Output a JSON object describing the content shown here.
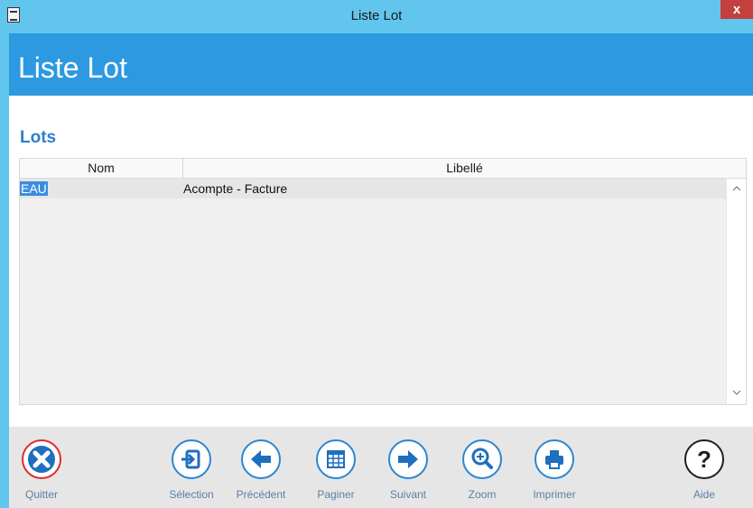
{
  "window": {
    "title": "Liste Lot",
    "close_label": "x"
  },
  "header": {
    "title": "Liste Lot"
  },
  "section": {
    "title": "Lots"
  },
  "table": {
    "columns": [
      "Nom",
      "Libellé"
    ],
    "rows": [
      {
        "nom": "EAU",
        "libelle": "Acompte - Facture",
        "selected_column": "nom"
      }
    ]
  },
  "scroll": {
    "up": "^",
    "down": "v"
  },
  "toolbar": {
    "quitter": {
      "label": "Quitter",
      "icon": "close-icon",
      "color": "#e02a2a"
    },
    "selection": {
      "label": "Sélection",
      "icon": "enter-icon"
    },
    "precedent": {
      "label": "Précédent",
      "icon": "arrow-left-icon"
    },
    "paginer": {
      "label": "Paginer",
      "icon": "table-icon"
    },
    "suivant": {
      "label": "Suivant",
      "icon": "arrow-right-icon"
    },
    "zoom": {
      "label": "Zoom",
      "icon": "zoom-in-icon"
    },
    "imprimer": {
      "label": "Imprimer",
      "icon": "printer-icon"
    },
    "aide": {
      "label": "Aide",
      "icon": "help-icon"
    }
  },
  "colors": {
    "titlebar": "#62c5ee",
    "header": "#2c99e0",
    "accent": "#2a86d2",
    "danger": "#e02a2a",
    "selection": "#3b8de0"
  }
}
